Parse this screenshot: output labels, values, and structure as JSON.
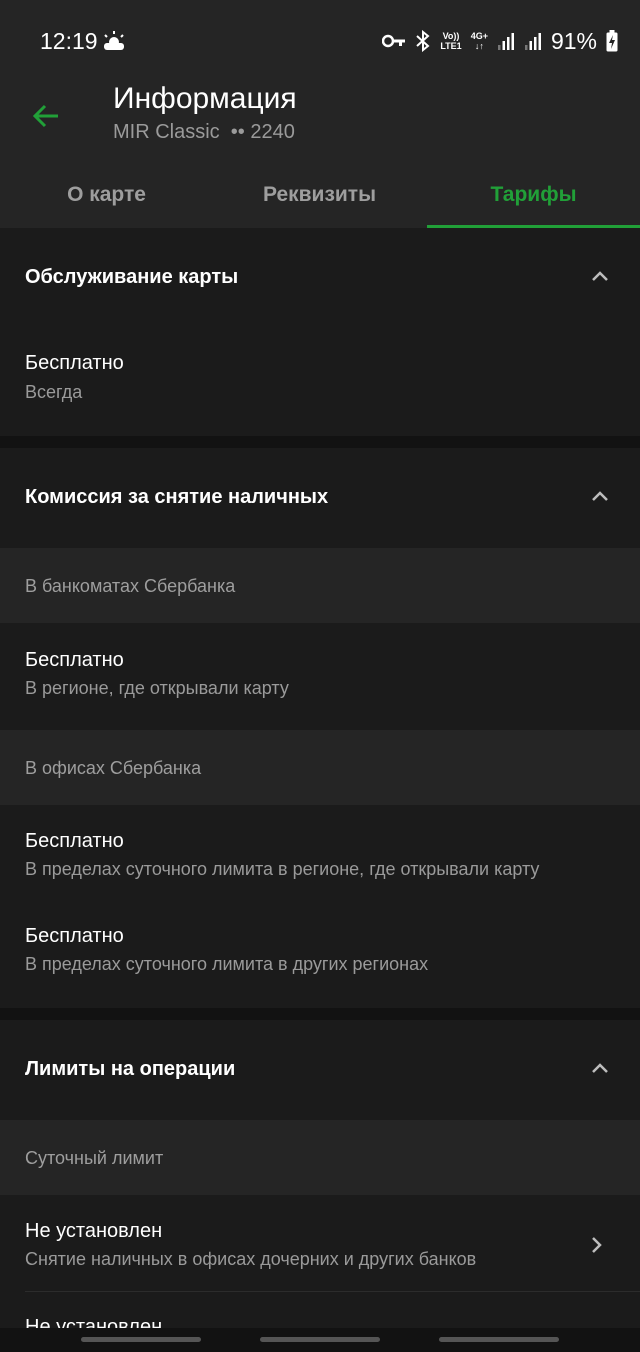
{
  "status_bar": {
    "time": "12:19",
    "weather_icon": "partly-cloudy-icon",
    "volte_top": "Vo))",
    "volte_bottom": "LTE1",
    "net_top": "4G+",
    "net_bottom": "↓↑",
    "battery": "91%"
  },
  "header": {
    "title": "Информация",
    "subtitle": "MIR Classic  •• 2240",
    "tabs": [
      {
        "label": "О карте",
        "active": false
      },
      {
        "label": "Реквизиты",
        "active": false
      },
      {
        "label": "Тарифы",
        "active": true
      }
    ]
  },
  "sections": {
    "service": {
      "title": "Обслуживание карты",
      "row": {
        "title": "Бесплатно",
        "subtitle": "Всегда"
      }
    },
    "cash": {
      "title": "Комиссия за снятие наличных",
      "atm_heading": "В банкоматах Сбербанка",
      "atm_row": {
        "title": "Бесплатно",
        "subtitle": "В регионе, где открывали карту"
      },
      "office_heading": "В офисах Сбербанка",
      "office_rows": [
        {
          "title": "Бесплатно",
          "subtitle": "В пределах суточного лимита в регионе, где открывали карту"
        },
        {
          "title": "Бесплатно",
          "subtitle": "В пределах суточного лимита в других регионах"
        }
      ]
    },
    "limits": {
      "title": "Лимиты на операции",
      "daily_heading": "Суточный лимит",
      "rows": [
        {
          "title": "Не установлен",
          "subtitle": "Снятие наличных в офисах дочерних и других банков"
        },
        {
          "title": "Не установлен",
          "subtitle": ""
        }
      ]
    }
  },
  "colors": {
    "accent": "#21a038",
    "background": "#121212",
    "card": "#1b1b1b",
    "header": "#252525"
  }
}
